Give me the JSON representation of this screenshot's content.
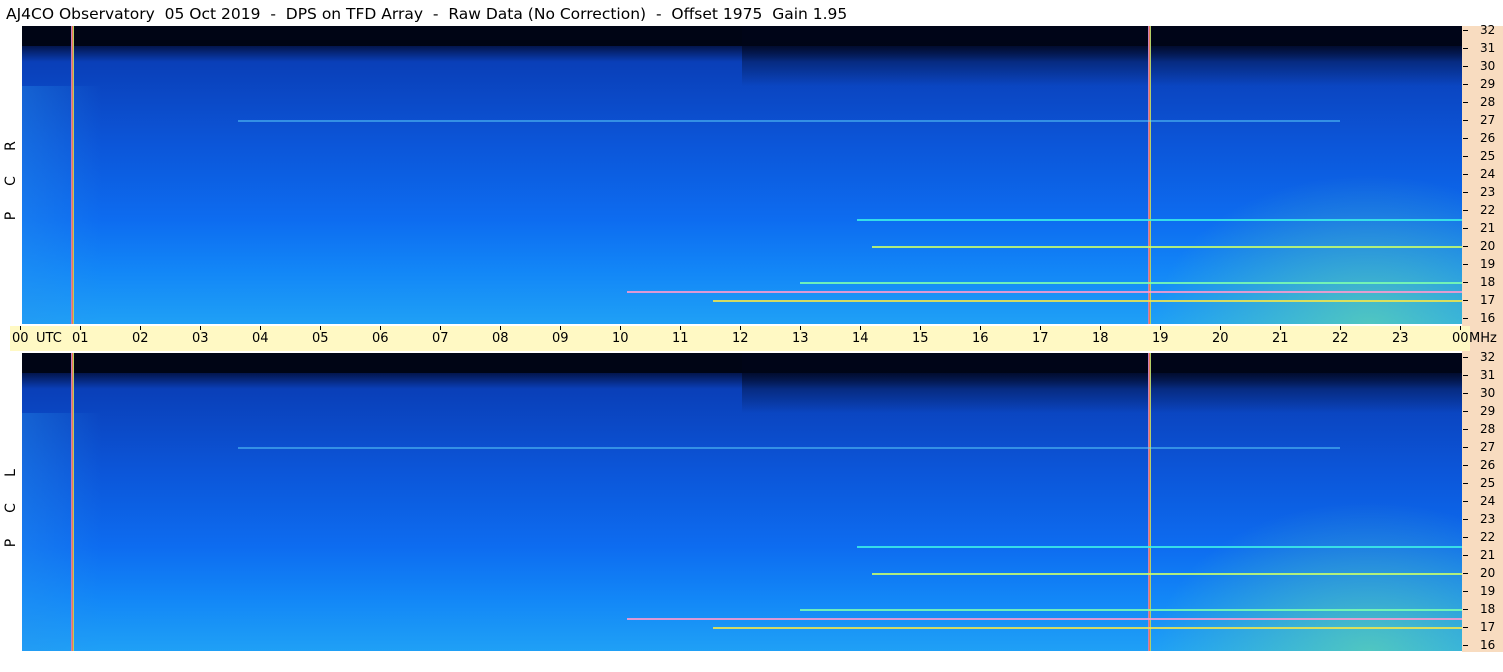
{
  "title": "AJ4CO Observatory  05 Oct 2019  -  DPS on TFD Array  -  Raw Data (No Correction)  -  Offset 1975  Gain 1.95",
  "time_axis": {
    "labels": [
      "00",
      "01",
      "02",
      "03",
      "04",
      "05",
      "06",
      "07",
      "08",
      "09",
      "10",
      "11",
      "12",
      "13",
      "14",
      "15",
      "16",
      "17",
      "18",
      "19",
      "20",
      "21",
      "22",
      "23",
      "00"
    ],
    "utc_label": "UTC",
    "unit": "MHz"
  },
  "freq_axis": {
    "ticks": [
      "32",
      "31",
      "30",
      "29",
      "28",
      "27",
      "26",
      "25",
      "24",
      "23",
      "22",
      "21",
      "20",
      "19",
      "18",
      "17",
      "16"
    ]
  },
  "panels": [
    {
      "id": "rcp",
      "letters": [
        "R",
        "C",
        "P"
      ]
    },
    {
      "id": "lcp",
      "letters": [
        "L",
        "C",
        "P"
      ]
    }
  ],
  "colors": {
    "background_night": "#000515",
    "spectrum_low": "#0c56d9",
    "spectrum_high": "#1fa0f6",
    "freq_bar": "#f8dcc0",
    "time_bar": "#fff9c4"
  },
  "chart_data": {
    "type": "heatmap",
    "title": "AJ4CO Observatory  05 Oct 2019  -  DPS on TFD Array  -  Raw Data (No Correction)  -  Offset 1975  Gain 1.95",
    "x_unit": "UTC",
    "y_unit": "MHz",
    "xlim": [
      0,
      24
    ],
    "ylim": [
      16,
      32
    ],
    "x_ticks": [
      "00",
      "01",
      "02",
      "03",
      "04",
      "05",
      "06",
      "07",
      "08",
      "09",
      "10",
      "11",
      "12",
      "13",
      "14",
      "15",
      "16",
      "17",
      "18",
      "19",
      "20",
      "21",
      "22",
      "23",
      "00"
    ],
    "y_ticks": [
      32,
      31,
      30,
      29,
      28,
      27,
      26,
      25,
      24,
      23,
      22,
      21,
      20,
      19,
      18,
      17,
      16
    ],
    "series": [
      {
        "name": "RCP"
      },
      {
        "name": "LCP"
      }
    ],
    "markers_utc": [
      0.85,
      18.8
    ],
    "notable_interference_bands_mhz": [
      17.0,
      17.5,
      18.0,
      20.0,
      21.5,
      27.0
    ]
  }
}
